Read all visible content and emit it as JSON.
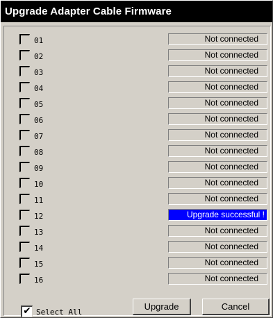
{
  "window": {
    "title": "Upgrade Adapter Cable Firmware"
  },
  "ports": [
    {
      "label": "01",
      "status": "Not connected",
      "state": "normal"
    },
    {
      "label": "02",
      "status": "Not connected",
      "state": "normal"
    },
    {
      "label": "03",
      "status": "Not connected",
      "state": "normal"
    },
    {
      "label": "04",
      "status": "Not connected",
      "state": "normal"
    },
    {
      "label": "05",
      "status": "Not connected",
      "state": "normal"
    },
    {
      "label": "06",
      "status": "Not connected",
      "state": "normal"
    },
    {
      "label": "07",
      "status": "Not connected",
      "state": "normal"
    },
    {
      "label": "08",
      "status": "Not connected",
      "state": "normal"
    },
    {
      "label": "09",
      "status": "Not connected",
      "state": "normal"
    },
    {
      "label": "10",
      "status": "Not connected",
      "state": "normal"
    },
    {
      "label": "11",
      "status": "Not connected",
      "state": "normal"
    },
    {
      "label": "12",
      "status": "Upgrade successful !",
      "state": "success"
    },
    {
      "label": "13",
      "status": "Not connected",
      "state": "normal"
    },
    {
      "label": "14",
      "status": "Not connected",
      "state": "normal"
    },
    {
      "label": "15",
      "status": "Not connected",
      "state": "normal"
    },
    {
      "label": "16",
      "status": "Not connected",
      "state": "normal"
    }
  ],
  "footer": {
    "select_all_label": "Select All",
    "select_all_checked": true,
    "upgrade_label": "Upgrade",
    "cancel_label": "Cancel"
  },
  "colors": {
    "window_bg": "#d4d0c8",
    "title_bg": "#000000",
    "success_bg": "#0000ff"
  }
}
